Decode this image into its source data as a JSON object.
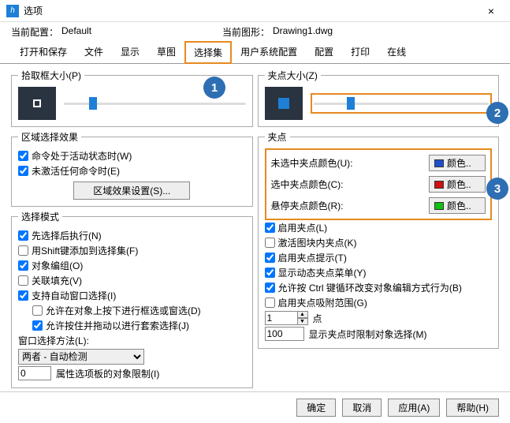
{
  "window": {
    "title": "选项",
    "close": "×",
    "icon": "h"
  },
  "config": {
    "label": "当前配置：",
    "value": "Default"
  },
  "drawing": {
    "label": "当前图形：",
    "value": "Drawing1.dwg"
  },
  "tabs": [
    "打开和保存",
    "文件",
    "显示",
    "草图",
    "选择集",
    "用户系统配置",
    "配置",
    "打印",
    "在线"
  ],
  "left": {
    "pickbox": {
      "legend": "拾取框大小(P)"
    },
    "region": {
      "legend": "区域选择效果",
      "c1": "命令处于活动状态时(W)",
      "c2": "未激活任何命令时(E)",
      "btn": "区域效果设置(S)..."
    },
    "mode": {
      "legend": "选择模式",
      "c1": "先选择后执行(N)",
      "c2": "用Shift键添加到选择集(F)",
      "c3": "对象编组(O)",
      "c4": "关联填充(V)",
      "c5": "支持自动窗口选择(I)",
      "c5a": "允许在对象上按下进行框选或窗选(D)",
      "c5b": "允许按住并拖动以进行套索选择(J)",
      "wlabel": "窗口选择方法(L):",
      "wsel": "两者 - 自动检测",
      "limval": "0",
      "limlabel": "属性选项板的对象限制(I)"
    }
  },
  "right": {
    "gripsize": {
      "legend": "夹点大小(Z)"
    },
    "grips": {
      "legend": "夹点",
      "r1": "未选中夹点颜色(U):",
      "r2": "选中夹点颜色(C):",
      "r3": "悬停夹点颜色(R):",
      "colorLabel": "颜色..",
      "col1": "#1e4fd0",
      "col2": "#d01010",
      "col3": "#10c010",
      "c1": "启用夹点(L)",
      "c2": "激活图块内夹点(K)",
      "c3": "启用夹点提示(T)",
      "c4": "显示动态夹点菜单(Y)",
      "c5": "允许按 Ctrl 键循环改变对象编辑方式行为(B)",
      "c6": "启用夹点吸附范围(G)",
      "spin": "1",
      "spinlabel": "点",
      "lim": "100",
      "limlabel": "显示夹点时限制对象选择(M)"
    }
  },
  "callouts": {
    "a": "1",
    "b": "2",
    "c": "3"
  },
  "footer": {
    "ok": "确定",
    "cancel": "取消",
    "apply": "应用(A)",
    "help": "帮助(H)"
  }
}
